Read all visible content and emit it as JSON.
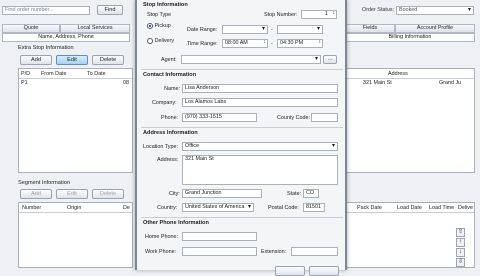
{
  "toolbar": {
    "find_placeholder": "Find order number...",
    "find_button": "Find",
    "order_status_label": "Order Status:",
    "order_status_value": "Booked"
  },
  "left_tabs": [
    "Quote",
    "Local Services",
    "Name, Address, Phone"
  ],
  "right_tabs": [
    "Fields",
    "Account Profile",
    "Billing Information"
  ],
  "extra_stop": {
    "title": "Extra Stop Information",
    "add": "Add",
    "edit": "Edit",
    "delete": "Delete",
    "columns": [
      "P/D",
      "From Date",
      "To Date"
    ],
    "row": {
      "pd": "P1",
      "from": "",
      "to": "08"
    },
    "right_columns": [
      "Address"
    ],
    "right_row": {
      "address": "321 Main St",
      "city": "Grand Ju"
    }
  },
  "segment": {
    "title": "Segment Information",
    "add": "Add",
    "edit": "Edit",
    "delete": "Delete",
    "columns": [
      "Number",
      "Origin",
      "De"
    ],
    "right_columns": [
      "Pack Date",
      "Load Date",
      "Load Time",
      "Delive"
    ]
  },
  "dialog": {
    "stop_info_title": "Stop Information",
    "stop_type_label": "Stop Type",
    "pickup": "Pickup",
    "delivery": "Delivery",
    "stop_number_label": "Stop Number:",
    "stop_number": "1",
    "date_range_label": "Date Range:",
    "date_from": "",
    "date_to": "",
    "time_range_label": "Time Range:",
    "time_from": "08:00 AM",
    "time_to": "04:30 PM",
    "agent_label": "Agent:",
    "agent": "",
    "contact_title": "Contact Information",
    "name_label": "Name:",
    "name": "Lisa Anderson",
    "company_label": "Company:",
    "company": "Los Alamos Labs",
    "phone_label": "Phone:",
    "phone": "(970) 333-1515",
    "county_code_label": "County Code:",
    "county_code": "",
    "address_title": "Address Information",
    "location_type_label": "Location Type:",
    "location_type": "Office",
    "address_label": "Address:",
    "address": "321 Main St",
    "city_label": "City:",
    "city": "Grand Junction",
    "state_label": "State:",
    "state": "CO",
    "country_label": "Country:",
    "country": "United States of America",
    "postal_label": "Postal Code:",
    "postal": "81501",
    "other_phone_title": "Other Phone Information",
    "home_phone_label": "Home Phone:",
    "home_phone": "",
    "work_phone_label": "Work Phone:",
    "work_phone": "",
    "extension_label": "Extension:",
    "extension": ""
  }
}
